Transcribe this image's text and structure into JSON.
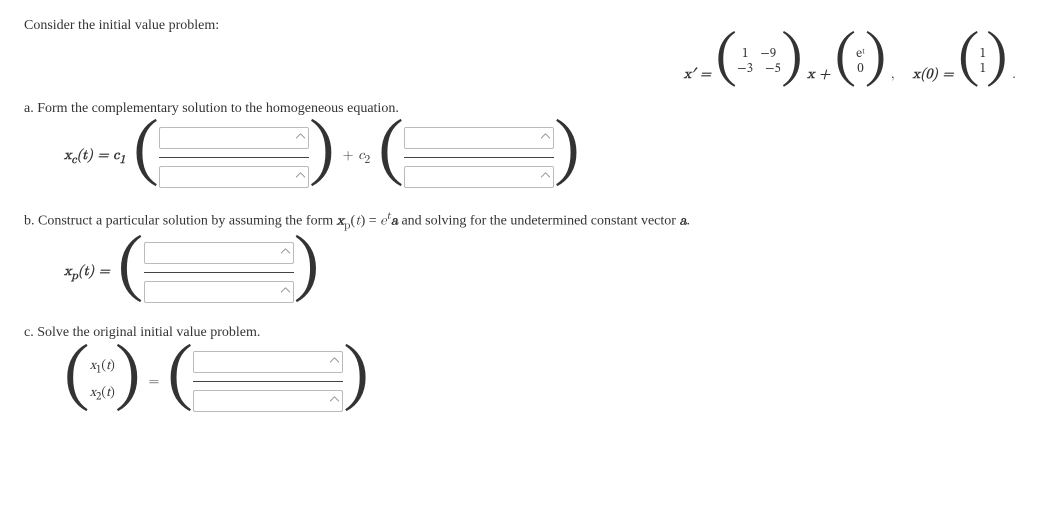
{
  "intro": "Consider the initial value problem:",
  "equation": {
    "lhs": "x′ =",
    "matrix": {
      "r1c1": "1",
      "r1c2": "−9",
      "r2c1": "−3",
      "r2c2": "−5"
    },
    "between1": "x +",
    "forcing": {
      "r1": "eᵗ",
      "r2": "0"
    },
    "comma": ",",
    "iclhs": "x(0) =",
    "ic": {
      "r1": "1",
      "r2": "1"
    },
    "period": "."
  },
  "parts": {
    "a": {
      "prompt": "a. Form the complementary solution to the homogeneous equation.",
      "lhs": "x_c(t) = c₁",
      "mid": "+ c₂"
    },
    "b": {
      "prompt": "b. Construct a particular solution by assuming the form x_p(t) = eᵗa and solving for the undetermined constant vector a.",
      "lhs": "x_p(t) ="
    },
    "c": {
      "prompt": "c. Solve the original initial value problem.",
      "x1": "x₁(t)",
      "x2": "x₂(t)",
      "eq": "="
    }
  }
}
